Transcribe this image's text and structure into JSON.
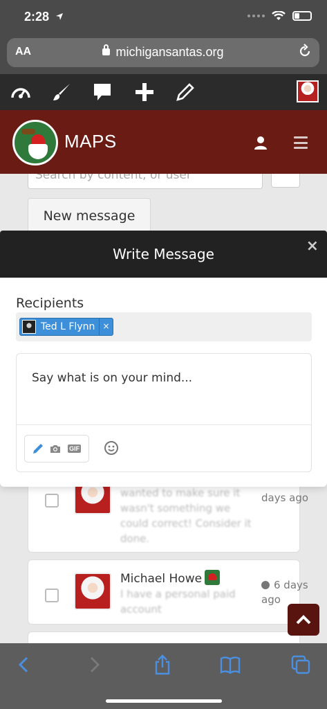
{
  "status_bar": {
    "time": "2:28"
  },
  "browser": {
    "text_size_label": "AA",
    "url": "michigansantas.org"
  },
  "header": {
    "title": "MAPS"
  },
  "page": {
    "search_placeholder": "Search by content, or user",
    "new_message_label": "New message",
    "messages": [
      {
        "preview": "wanted to make sure it wasn't something we could correct! Consider it done.",
        "time": "days ago"
      },
      {
        "name": "Michael Howe",
        "preview": "I have a personal paid account",
        "time": "6 days ago"
      }
    ]
  },
  "modal": {
    "title": "Write Message",
    "close_label": "×",
    "recipients_label": "Recipients",
    "recipients": [
      {
        "name": "Ted L Flynn",
        "remove_label": "×"
      }
    ],
    "editor_placeholder": "Say what is on your mind...",
    "gif_label": "GIF"
  },
  "colors": {
    "header_bg": "#6a1b14",
    "toolbar_bg": "#2b2b2b",
    "modal_header_bg": "#222222",
    "chip_bg": "#3d8fd9",
    "safari_blue": "#4a8fe0"
  }
}
